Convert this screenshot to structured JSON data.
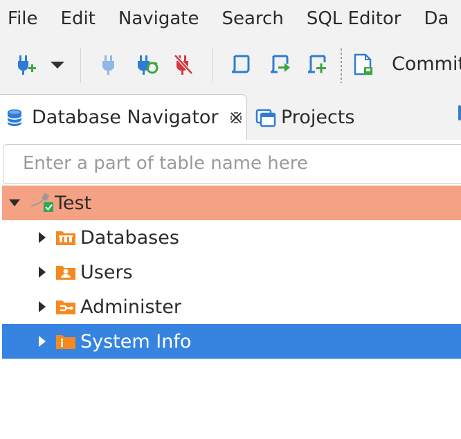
{
  "menu": [
    "File",
    "Edit",
    "Navigate",
    "Search",
    "SQL Editor",
    "Da"
  ],
  "toolbar": {
    "buttons": [
      "new-connection-icon",
      "dropdown-arrow-icon",
      "connect-icon",
      "reconnect-icon",
      "disconnect-icon",
      "sql-editor-icon",
      "open-sql-script-icon",
      "new-sql-script-icon",
      "commit-mode-icon"
    ],
    "commit_label": "Commit"
  },
  "tabs": {
    "active": "Database Navigator",
    "inactive": "Projects"
  },
  "search": {
    "placeholder": "Enter a part of table name here",
    "value": ""
  },
  "tree": {
    "root": {
      "label": "Test",
      "expanded": true,
      "color": "#f5a183"
    },
    "children": [
      {
        "label": "Databases",
        "icon": "databases-folder-icon"
      },
      {
        "label": "Users",
        "icon": "users-folder-icon"
      },
      {
        "label": "Administer",
        "icon": "administer-folder-icon"
      },
      {
        "label": "System Info",
        "icon": "system-info-folder-icon",
        "selected": true
      }
    ]
  },
  "colors": {
    "selection": "#3684e0",
    "connection_highlight": "#f5a183",
    "folder_orange": "#f5891f"
  }
}
